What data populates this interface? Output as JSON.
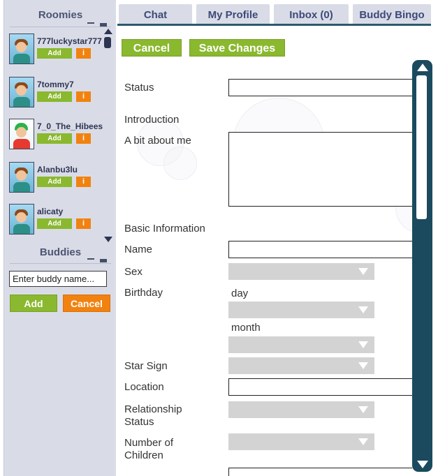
{
  "sidebar": {
    "roomies_title": "Roomies",
    "roomies": [
      {
        "username": "777luckystar777",
        "add_label": "Add",
        "info_label": "i",
        "avatar": "boy-avatar"
      },
      {
        "username": "7tommy7",
        "add_label": "Add",
        "info_label": "i",
        "avatar": "boy-avatar"
      },
      {
        "username": "7_0_The_Hibees",
        "add_label": "Add",
        "info_label": "i",
        "avatar": "clown-avatar"
      },
      {
        "username": "Alanbu3lu",
        "add_label": "Add",
        "info_label": "i",
        "avatar": "boy-avatar"
      },
      {
        "username": "alicaty",
        "add_label": "Add",
        "info_label": "i",
        "avatar": "boy-avatar"
      }
    ],
    "buddies_title": "Buddies",
    "buddy_input_placeholder": "Enter buddy name...",
    "add_button": "Add",
    "cancel_button": "Cancel"
  },
  "tabs": [
    {
      "label": "Chat"
    },
    {
      "label": "My Profile"
    },
    {
      "label": "Inbox (0)"
    },
    {
      "label": "Buddy Bingo"
    }
  ],
  "actions": {
    "cancel": "Cancel",
    "save": "Save Changes"
  },
  "form": {
    "status_label": "Status",
    "introduction_label": "Introduction",
    "about_label": "A bit about me",
    "basic_info_label": "Basic Information",
    "name_label": "Name",
    "sex_label": "Sex",
    "birthday_label": "Birthday",
    "day_label": "day",
    "month_label": "month",
    "star_sign_label": "Star Sign",
    "location_label": "Location",
    "relationship_label": "Relationship Status",
    "children_label": "Number of Children",
    "status_value": "",
    "about_value": "",
    "name_value": "",
    "location_value": ""
  },
  "colors": {
    "accent_green": "#8ab82f",
    "accent_orange": "#f1820f",
    "sidebar_bg": "#d9dce7",
    "tab_text": "#3d4a78",
    "scrollbar": "#1b4a5e"
  }
}
